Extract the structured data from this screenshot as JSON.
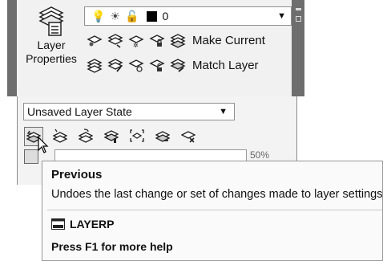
{
  "ribbon_panel": {
    "layer_properties_label_line1": "Layer",
    "layer_properties_label_line2": "Properties",
    "layer_dropdown": {
      "icons": [
        "lightbulb-icon",
        "sun-icon",
        "unlock-icon",
        "color-swatch-icon"
      ],
      "swatch_color": "#000000",
      "value": "0"
    },
    "row1": {
      "icons": [
        "layer-off-icon",
        "layer-isolate-icon",
        "layer-freeze-icon",
        "layer-lock-icon",
        "make-current-icon"
      ],
      "label": "Make Current"
    },
    "row2": {
      "icons": [
        "layer-unisolate-icon",
        "layer-walk-icon",
        "layer-thaw-icon",
        "layer-unlock-icon",
        "match-layer-icon"
      ],
      "label": "Match Layer"
    },
    "layer_state_dropdown": {
      "value": "Unsaved Layer State"
    },
    "state_tools": [
      "previous-icon",
      "change-to-current-icon",
      "copy-objects-icon",
      "merge-icon",
      "walk-icon",
      "delete-layer-icon",
      "remove-icon"
    ],
    "zoom_percent_partial": "50%"
  },
  "tooltip": {
    "title": "Previous",
    "description": "Undoes the last change or set of changes made to layer settings",
    "command_icon": "command-window-icon",
    "command": "LAYERP",
    "help": "Press F1 for more help"
  }
}
